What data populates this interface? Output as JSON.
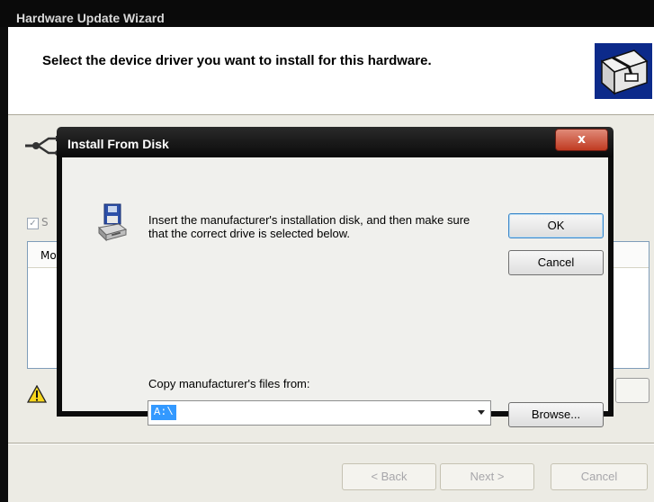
{
  "wizard": {
    "title": "Hardware Update Wizard",
    "heading": "Select the device driver you want to install for this hardware.",
    "partial_checkbox_text": "S",
    "partial_list_header": "Mo",
    "back_label": "< Back",
    "next_label": "Next >",
    "cancel_label": "Cancel"
  },
  "dialog": {
    "title": "Install From Disk",
    "close_label": "x",
    "message": "Insert the manufacturer's installation disk, and then make sure that the correct drive is selected below.",
    "ok_label": "OK",
    "cancel_label": "Cancel",
    "copy_label": "Copy manufacturer's files from:",
    "path_value": "A:\\",
    "browse_label": "Browse..."
  }
}
